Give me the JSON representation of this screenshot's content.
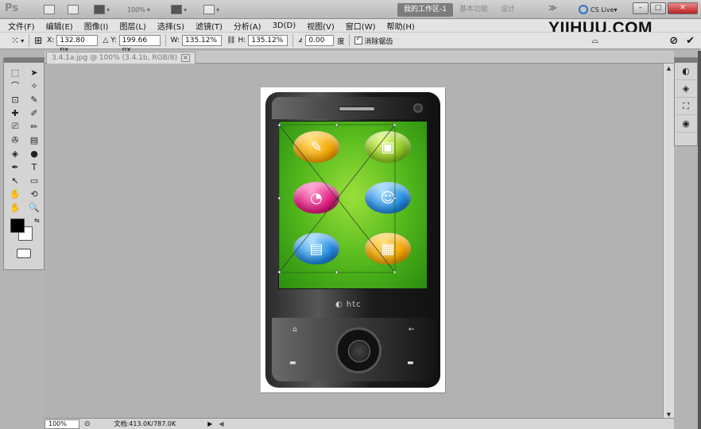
{
  "app": {
    "logo": "Ps",
    "zoom_preset": "100%",
    "workspaces": [
      "我的工作区-1",
      "基本功能",
      "设计"
    ],
    "more": "≫",
    "cslive": "CS Live▾",
    "window_controls": [
      "–",
      "□",
      "✕"
    ]
  },
  "watermark": "YIIHUU.COM",
  "menu": [
    "文件(F)",
    "编辑(E)",
    "图像(I)",
    "图层(L)",
    "选择(S)",
    "滤镜(T)",
    "分析(A)",
    "3D(D)",
    "视图(V)",
    "窗口(W)",
    "帮助(H)"
  ],
  "options": {
    "x_label": "X:",
    "x_value": "132.80 px",
    "y_label": "Y:",
    "y_value": "199.66 px",
    "w_label": "W:",
    "w_value": "135.12%",
    "h_label": "H:",
    "h_value": "135.12%",
    "angle_value": "0.00",
    "angle_unit": "度",
    "antialias_label": "消除锯齿",
    "cancel": "⊘",
    "commit": "✔"
  },
  "document": {
    "tab_title": "3.4.1a.jpg @ 100% (3.4.1b, RGB/8)",
    "tab_close": "×",
    "zoom": "100%",
    "doc_info": "文档:413.0K/787.0K",
    "brand": "htc"
  },
  "tools": [
    "⬚",
    "➤",
    "⌒",
    "✧",
    "⊡",
    "✎",
    "✚",
    "✐",
    "⎚",
    "✏",
    "✇",
    "▤",
    "◈",
    "●",
    "✒",
    "T",
    "↖",
    "▭",
    "✋",
    "⟲",
    "✋",
    "🔍"
  ],
  "right_panel": [
    "◐",
    "◈",
    "⛶",
    "◉"
  ],
  "colors": {
    "foreground": "#000000",
    "background": "#ffffff",
    "screen_green": "#4fb51b",
    "icon_orange": "#f2a300",
    "icon_lime": "#8ac31c",
    "icon_pink": "#e0157a",
    "icon_blue": "#1e88e0"
  }
}
